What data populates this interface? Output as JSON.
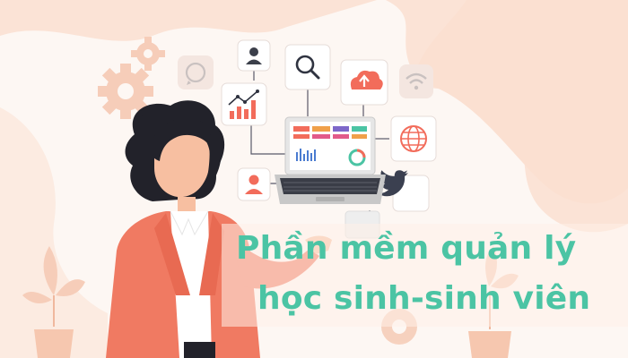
{
  "title": {
    "line1": "Phần mềm quản lý",
    "line2": "học sinh-sinh viên"
  },
  "colors": {
    "background": "#fdf7f3",
    "blob": "#fbe1d3",
    "accent_text": "#4bc4a4",
    "brand_red": "#f26c5b",
    "blazer": "#f07a62",
    "gear": "#f6cdb9"
  },
  "icons": [
    "whatsapp-icon",
    "user-icon",
    "search-icon",
    "cloud-upload-icon",
    "wifi-icon",
    "chart-icon",
    "globe-icon",
    "twitter-icon",
    "gear-icon",
    "plant-icon"
  ]
}
